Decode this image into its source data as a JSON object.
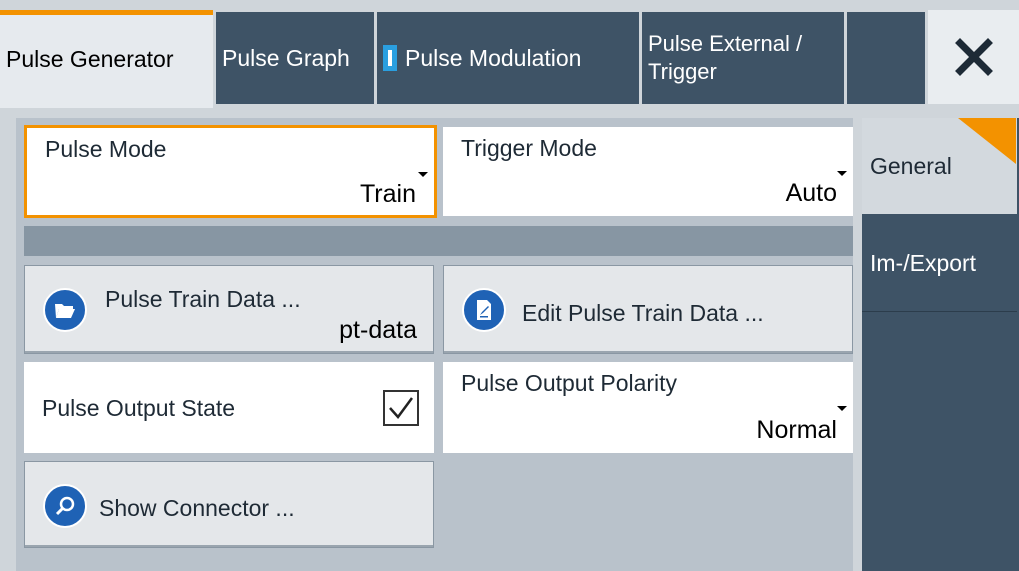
{
  "tabs": [
    {
      "label": "Pulse Generator"
    },
    {
      "label": "Pulse Graph"
    },
    {
      "label": "Pulse Modulation"
    },
    {
      "label_line1": "Pulse External /",
      "label_line2": "Trigger"
    }
  ],
  "pulse_mode": {
    "label": "Pulse Mode",
    "value": "Train"
  },
  "trigger_mode": {
    "label": "Trigger Mode",
    "value": "Auto"
  },
  "pulse_train_data": {
    "label": "Pulse Train Data ...",
    "value": "pt-data"
  },
  "edit_pulse_train": {
    "label": "Edit Pulse Train Data ..."
  },
  "pulse_output_state": {
    "label": "Pulse Output State",
    "checked": true
  },
  "pulse_output_polarity": {
    "label": "Pulse Output Polarity",
    "value": "Normal"
  },
  "show_connector": {
    "label": "Show Connector ..."
  },
  "side_tabs": [
    {
      "label": "General"
    },
    {
      "label": "Im-/Export"
    }
  ],
  "colors": {
    "accent": "#f39200",
    "tab_bg": "#3e5366",
    "icon_blue": "#1f62b5"
  }
}
